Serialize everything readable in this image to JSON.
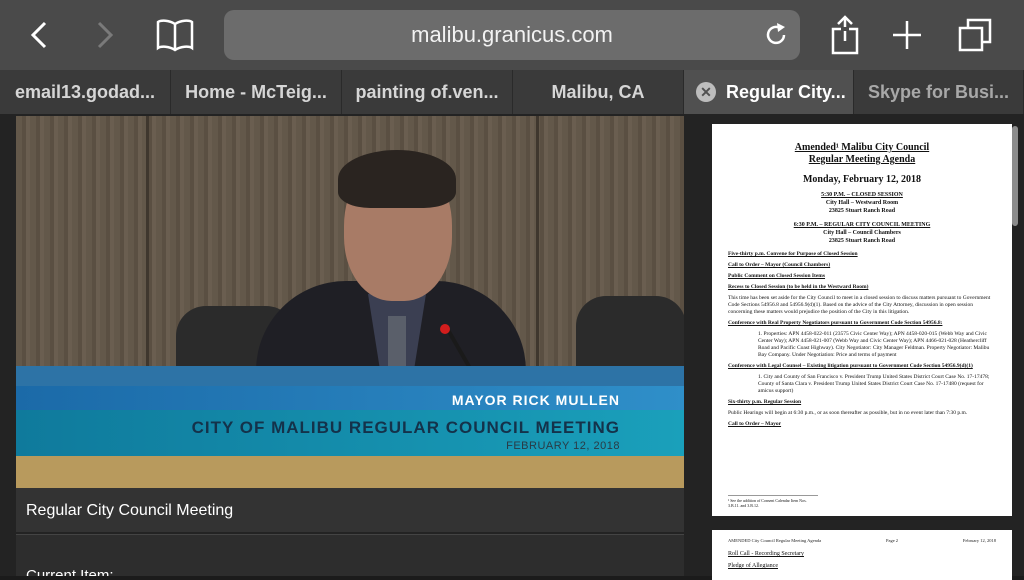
{
  "toolbar": {
    "url": "malibu.granicus.com",
    "icons": [
      "back-icon",
      "forward-icon",
      "bookmarks-icon",
      "reload-icon",
      "share-icon",
      "new-tab-icon",
      "tabs-icon"
    ]
  },
  "tabs": [
    {
      "label": "email13.godad..."
    },
    {
      "label": "Home - McTeig..."
    },
    {
      "label": "painting of.ven..."
    },
    {
      "label": "Malibu, CA"
    },
    {
      "label": "Regular City...",
      "active": true
    },
    {
      "label": "Skype for Busi..."
    }
  ],
  "video": {
    "lower_third_name": "MAYOR RICK MULLEN",
    "lower_third_title": "CITY OF MALIBU REGULAR COUNCIL MEETING",
    "lower_third_date": "FEBRUARY 12, 2018",
    "caption": "Regular City Council Meeting",
    "current_item": "Current Item:"
  },
  "agenda": {
    "title1": "Amended¹ Malibu City Council",
    "title2": "Regular Meeting Agenda",
    "date": "Monday, February 12, 2018",
    "closed_session": "5:30 P.M. – CLOSED SESSION",
    "closed_location1": "City Hall – Westward Room",
    "closed_location2": "23825 Stuart Ranch Road",
    "regular_session": "6:30 P.M. – REGULAR CITY COUNCIL MEETING",
    "regular_location1": "City Hall – Council Chambers",
    "regular_location2": "23825 Stuart Ranch Road",
    "item1": "Five-thirty p.m.     Convene for Purpose of Closed Session",
    "item2": "Call to Order – Mayor (Council Chambers)",
    "item3": "Public Comment on Closed Session Items",
    "item4": "Recess to Closed Session (to be held in the Westward Room)",
    "item4_text": "This time has been set aside for the City Council to meet in a closed session to discuss matters pursuant to Government Code Sections 54956.8 and 54956.9(d)(1). Based on the advice of the City Attorney, discussion in open session concerning these matters would prejudice the position of the City in this litigation.",
    "item5": "Conference with Real Property Negotiators pursuant to Government Code Section 54956.8:",
    "item5_text": "1. Properties: APN 4458-022-011 (23575 Civic Center Way); APN 4458-020-015 (Webb Way and Civic Center Way); APN 4458-021-007 (Webb Way and Civic Center Way); APN 4466-021-028 (Heathercliff Road and Pacific Coast Highway). City Negotiator: City Manager Feldman. Property Negotiator: Malibu Bay Company. Under Negotiation: Price and terms of payment",
    "item6": "Conference with Legal Counsel – Existing litigation pursuant to Government Code Section 54956.9(d)(1)",
    "item6_text": "1. City and County of San Francisco v. President Trump United States District Court Case No. 17-17478; County of Santa Clara v. President Trump United States District Court Case No. 17-17480 (request for amicus support)",
    "item7": "Six-thirty p.m.     Regular Session",
    "item7_text": "Public Hearings will begin at 6:30 p.m., or as soon thereafter as possible, but in no event later than 7:30 p.m.",
    "item8": "Call to Order – Mayor",
    "footnote": "¹ See the addition of Consent Calendar Item Nos. 3.B.11. and 3.B.12.",
    "page2_header_left": "AMENDED City Council Regular Meeting Agenda",
    "page2_header_mid": "Page 2",
    "page2_header_right": "February 12, 2018",
    "page2_item1": "Roll Call - Recording Secretary",
    "page2_item2": "Pledge of Allegiance"
  }
}
